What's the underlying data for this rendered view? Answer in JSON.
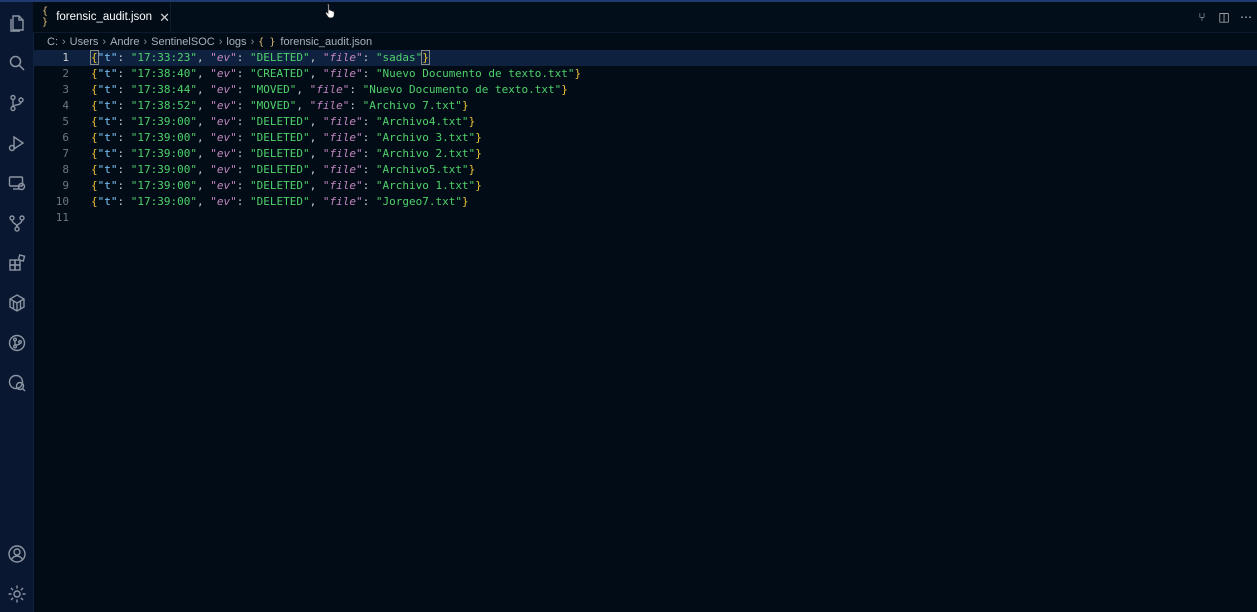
{
  "tab": {
    "icon": "{ }",
    "label": "forensic_audit.json",
    "close": "✕"
  },
  "tab_actions": [
    "⑂",
    "◫",
    "⋯"
  ],
  "breadcrumb": {
    "items": [
      "C:",
      "Users",
      "Andre",
      "SentinelSOC",
      "logs"
    ],
    "file_icon": "{ }",
    "file": "forensic_audit.json",
    "sep": "›"
  },
  "activity_icons": [
    "files-icon",
    "search-icon",
    "source-control-icon",
    "run-debug-icon",
    "remote-explorer-icon",
    "git-graph-icon",
    "extensions-icon",
    "containers-icon",
    "git-lens-icon",
    "accounts-search-icon"
  ],
  "bottom_icons": [
    "account-icon",
    "settings-gear-icon"
  ],
  "colors": {
    "brace": "#f1c232",
    "key_t": "#7ec8ff",
    "key_italic": "#c586c0",
    "string": "#4fd16a"
  },
  "lines": [
    {
      "n": "1",
      "t": "\"17:33:23\"",
      "ev": "\"DELETED\"",
      "file": "\"sadas\""
    },
    {
      "n": "2",
      "t": "\"17:38:40\"",
      "ev": "\"CREATED\"",
      "file": "\"Nuevo Documento de texto.txt\""
    },
    {
      "n": "3",
      "t": "\"17:38:44\"",
      "ev": "\"MOVED\"",
      "file": "\"Nuevo Documento de texto.txt\""
    },
    {
      "n": "4",
      "t": "\"17:38:52\"",
      "ev": "\"MOVED\"",
      "file": "\"Archivo 7.txt\""
    },
    {
      "n": "5",
      "t": "\"17:39:00\"",
      "ev": "\"DELETED\"",
      "file": "\"Archivo4.txt\""
    },
    {
      "n": "6",
      "t": "\"17:39:00\"",
      "ev": "\"DELETED\"",
      "file": "\"Archivo 3.txt\""
    },
    {
      "n": "7",
      "t": "\"17:39:00\"",
      "ev": "\"DELETED\"",
      "file": "\"Archivo 2.txt\""
    },
    {
      "n": "8",
      "t": "\"17:39:00\"",
      "ev": "\"DELETED\"",
      "file": "\"Archivo5.txt\""
    },
    {
      "n": "9",
      "t": "\"17:39:00\"",
      "ev": "\"DELETED\"",
      "file": "\"Archivo 1.txt\""
    },
    {
      "n": "10",
      "t": "\"17:39:00\"",
      "ev": "\"DELETED\"",
      "file": "\"Jorgeo7.txt\""
    }
  ],
  "last_line": "11",
  "json_tokens": {
    "k_t": "\"t\"",
    "k_ev": "\"ev\"",
    "k_file": "\"file\"",
    "colon": ": ",
    "comma": ", ",
    "open": "{",
    "close": "}"
  }
}
